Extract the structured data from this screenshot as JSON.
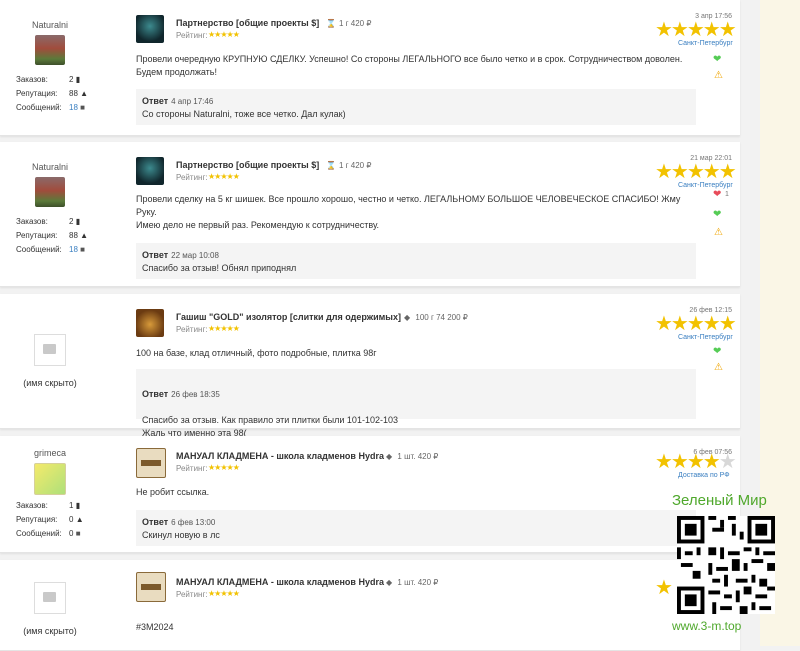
{
  "labels": {
    "orders": "Заказов:",
    "reputation": "Репутация:",
    "messages": "Сообщений:",
    "rating": "Рейтинг:",
    "reply": "Ответ"
  },
  "reviews": [
    {
      "user": {
        "name": "Naturalni",
        "orders": "2",
        "reputation": "88",
        "messages": "18"
      },
      "product": {
        "title": "Партнерство [общие проекты $]",
        "price": "1 г 420 ₽",
        "price_icon": "hourglass-icon"
      },
      "date": "3 апр 17:56",
      "stars": 5,
      "city": "Санкт-Петербург",
      "text": "Провели очередную КРУПНУЮ СДЕЛКУ. Успешно! Со стороны ЛЕГАЛЬНОГО все было четко и в срок. Сотрудничеством доволен. Будем продолжать!",
      "reply": {
        "date": "4 апр 17:46",
        "text": "Со стороны Naturalni, тоже все четко. Дал кулак)"
      }
    },
    {
      "user": {
        "name": "Naturalni",
        "orders": "2",
        "reputation": "88",
        "messages": "18"
      },
      "product": {
        "title": "Партнерство [общие проекты $]",
        "price": "1 г 420 ₽",
        "price_icon": "hourglass-icon"
      },
      "date": "21 мар 22:01",
      "stars": 5,
      "city": "Санкт-Петербург",
      "likes": "1",
      "text": "Провели сделку на 5 кг шишек. Все прошло хорошо, честно и четко. ЛЕГАЛЬНОМУ БОЛЬШОЕ ЧЕЛОВЕЧЕСКОЕ СПАСИБО! Жму Руку.\nИмею дело не первый раз. Рекомендую к сотрудничеству.",
      "reply": {
        "date": "22 мар 10:08",
        "text": "Спасибо за отзыв! Обнял приподнял"
      }
    },
    {
      "user": {
        "name": "(имя скрыто)"
      },
      "product": {
        "title": "Гашиш \"GOLD\" изолятор [слитки для одержимых]",
        "price": "100 г 74 200 ₽",
        "price_icon": "diamond-icon"
      },
      "date": "26 фев 12:15",
      "stars": 5,
      "city": "Санкт-Петербург",
      "text": "100 на базе, клад отличный, фото подробные, плитка 98г",
      "reply": {
        "date": "26 фев 18:35",
        "text": "Спасибо за отзыв. Как правило эти плитки были 101-102-103\nЖаль что именно эта 98("
      }
    },
    {
      "user": {
        "name": "grimeca",
        "orders": "1",
        "reputation": "0",
        "messages": "0"
      },
      "product": {
        "title": "МАНУАЛ КЛАДМЕНА - школа кладменов Hydra",
        "price": "1 шт. 420 ₽",
        "price_icon": "diamond-icon"
      },
      "date": "6 фев 07:56",
      "stars": 4,
      "city": "Доставка по РФ",
      "text": "Не робит ссылка.",
      "reply": {
        "date": "6 фев 13:00",
        "text": "Скинул новую в лс"
      }
    },
    {
      "user": {
        "name": "(имя скрыто)"
      },
      "product": {
        "title": "МАНУАЛ КЛАДМЕНА - школа кладменов Hydra",
        "price": "1 шт. 420 ₽",
        "price_icon": "diamond-icon"
      },
      "text": "#3M2024"
    }
  ],
  "watermark": {
    "title": "Зеленый Мир",
    "url": "www.3-m.top"
  }
}
